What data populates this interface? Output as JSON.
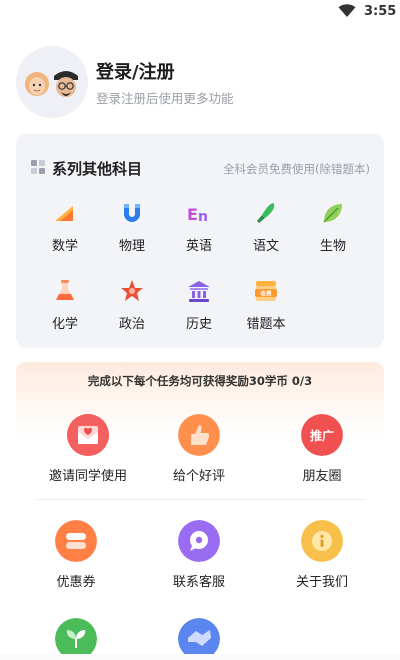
{
  "status_bar": {
    "time": "3:55"
  },
  "profile": {
    "title": "登录/注册",
    "subtitle": "登录注册后使用更多功能"
  },
  "subjects": {
    "title": "系列其他科目",
    "note": "全科会员免费使用(除错题本)",
    "items": [
      {
        "label": "数学",
        "icon": "math-icon"
      },
      {
        "label": "物理",
        "icon": "physics-icon"
      },
      {
        "label": "英语",
        "icon": "english-icon"
      },
      {
        "label": "语文",
        "icon": "chinese-icon"
      },
      {
        "label": "生物",
        "icon": "biology-icon"
      },
      {
        "label": "化学",
        "icon": "chemistry-icon"
      },
      {
        "label": "政治",
        "icon": "politics-icon"
      },
      {
        "label": "历史",
        "icon": "history-icon"
      },
      {
        "label": "错题本",
        "icon": "mistake-book-icon"
      }
    ],
    "mistake_badge": "收费"
  },
  "tasks": {
    "header": "完成以下每个任务均可获得奖励30学币 0/3",
    "items": [
      {
        "label": "邀请同学使用",
        "icon": "invite-icon"
      },
      {
        "label": "给个好评",
        "icon": "thumbs-up-icon"
      },
      {
        "label": "朋友圈",
        "icon": "promote-icon",
        "badge": "推广"
      }
    ]
  },
  "more": {
    "items": [
      {
        "label": "优惠券",
        "icon": "coupon-icon"
      },
      {
        "label": "联系客服",
        "icon": "customer-service-icon"
      },
      {
        "label": "关于我们",
        "icon": "about-icon"
      }
    ],
    "partial": [
      {
        "icon": "sprout-icon"
      },
      {
        "icon": "handshake-icon"
      }
    ]
  },
  "colors": {
    "accent_orange": "#ff8a3d",
    "accent_red": "#e84b4b",
    "accent_purple": "#8b6cf0",
    "accent_yellow": "#f6b632",
    "accent_green": "#4cbb5a",
    "accent_blue": "#4d7cf0"
  }
}
